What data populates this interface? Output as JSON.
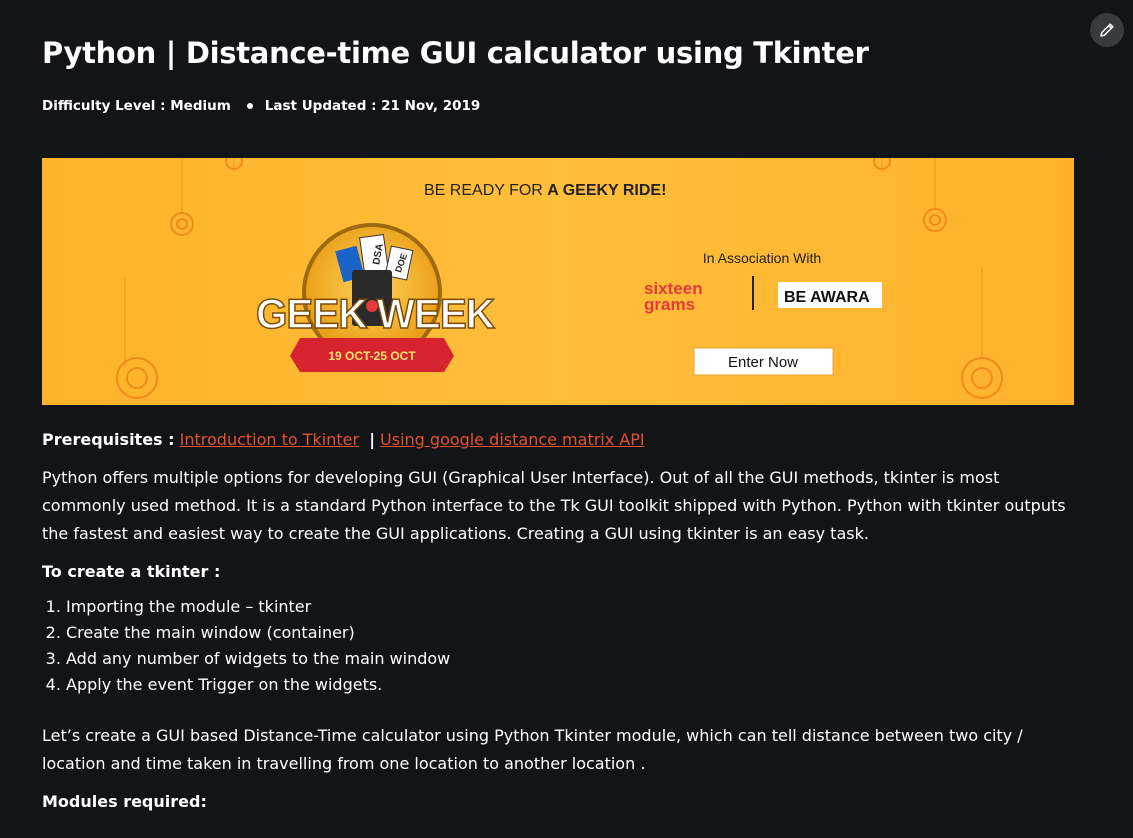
{
  "article": {
    "title": "Python | Distance-time GUI calculator using Tkinter",
    "difficulty": "Difficulty Level : Medium",
    "last_updated": "Last Updated : 21 Nov, 2019"
  },
  "toolbar": {
    "edit_icon": "pencil-icon"
  },
  "banner": {
    "headline_prefix": "BE READY FOR ",
    "headline_bold": "A GEEKY RIDE!",
    "logo_text": "GEEK WEEK",
    "ribbon_text": "19 OCT-25 OCT",
    "ticket_1": "DSA",
    "ticket_2": "DOE",
    "association": "In Association With",
    "partner_1_line_1": "sixteen",
    "partner_1_line_2": "grams",
    "partner_2": "BE AWARA",
    "cta": "Enter Now",
    "colors": {
      "background": "#ffb22a",
      "partner_1": "#e63a3a",
      "ribbon": "#d6232e"
    }
  },
  "prereq": {
    "label": "Prerequisites :",
    "link_1": "Introduction to Tkinter",
    "separator": "|",
    "link_2": "Using google distance matrix API",
    "link_color": "#e0552e"
  },
  "body": {
    "para_1": "Python offers multiple options for developing GUI (Graphical User Interface). Out of all the GUI methods, tkinter is most commonly used method. It is a standard Python interface to the Tk GUI toolkit shipped with Python. Python with tkinter outputs the fastest and easiest way to create the GUI applications. Creating a GUI using tkinter is an easy task.",
    "subheading": "To create a tkinter :",
    "steps": [
      "Importing the module – tkinter",
      "Create the main window (container)",
      "Add any number of widgets to the main window",
      "Apply the event Trigger on the widgets."
    ],
    "para_2": "Let’s create a GUI based Distance-Time calculator using Python Tkinter module, which can tell distance between two city / location and time taken in travelling from one location to another location .",
    "modules_heading": "Modules required:"
  }
}
